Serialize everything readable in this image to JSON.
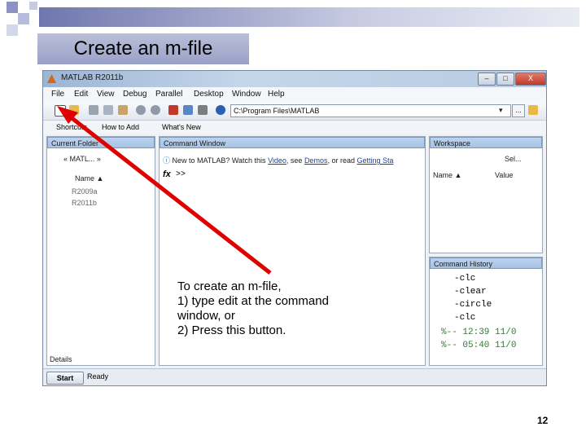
{
  "slide": {
    "title": "Create an m-file",
    "annotation_lines": [
      "To create an m-file,",
      "1) type edit at  the command",
      "window, or",
      "2) Press this button."
    ],
    "page_number": "12"
  },
  "matlab": {
    "window_title": "MATLAB  R2011b",
    "window_buttons": [
      "–",
      "□",
      "X"
    ],
    "menu": [
      "File",
      "Edit",
      "View",
      "Debug",
      "Parallel",
      "Desktop",
      "Window",
      "Help"
    ],
    "current_folder_path": "C:\\Program Files\\MATLAB",
    "path_browse": "...",
    "shortcuts": [
      "Shortcuts",
      "How to Add",
      "What's New"
    ],
    "current_folder": {
      "header": "Current Folder",
      "nav_text": "« MATL... »",
      "column_header": "Name ▲",
      "items": [
        "R2009a",
        "R2011b"
      ],
      "details_label": "Details"
    },
    "command_window": {
      "header": "Command Window",
      "info_prefix": "New to MATLAB? Watch this ",
      "info_link1": "Video",
      "info_mid1": ", see ",
      "info_link2": "Demos",
      "info_mid2": ", or read ",
      "info_link3": "Getting Sta",
      "fx_label": "fx",
      "prompt": ">>"
    },
    "workspace": {
      "header": "Workspace",
      "select_label": "Sel...",
      "col_name": "Name ▲",
      "col_value": "Value"
    },
    "command_history": {
      "header": "Command History",
      "entries": [
        "-clc",
        "-clear",
        "-circle",
        "-clc",
        "%-- 12:39 11/0",
        "%-- 05:40 11/0"
      ]
    },
    "status": {
      "start_label": "Start",
      "status_text": "Ready"
    }
  },
  "colors": {
    "arrow": "#e00000",
    "accent": "#9aa1c7"
  }
}
